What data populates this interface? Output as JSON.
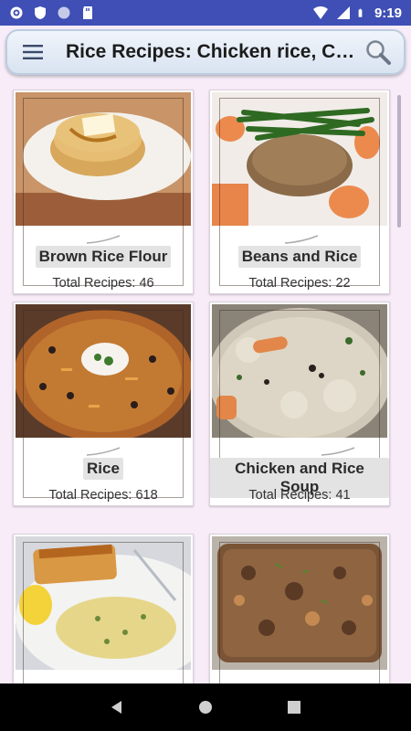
{
  "status_bar": {
    "time": "9:19",
    "left_icons": [
      "gear-icon",
      "shield-icon",
      "circle-icon",
      "sd-card-icon"
    ],
    "right_icons": [
      "wifi-icon",
      "signal-icon",
      "battery-icon"
    ]
  },
  "app_bar": {
    "title": "Rice Recipes: Chicken rice, Chicken and rice"
  },
  "colors": {
    "status_bar": "#3f4fb5",
    "background": "#f7ecf7",
    "nav_bar": "#000000"
  },
  "categories": [
    {
      "title": "Brown Rice Flour",
      "count_text": "Total Recipes: 46",
      "image": "pancakes"
    },
    {
      "title": "Beans and Rice",
      "count_text": "Total Recipes: 22",
      "image": "beans-rice"
    },
    {
      "title": "Rice",
      "count_text": "Total Recipes: 618",
      "image": "mexican-rice"
    },
    {
      "title": "Chicken and Rice Soup",
      "count_text": "Total Recipes: 41",
      "image": "soup"
    },
    {
      "title": "",
      "count_text": "",
      "image": "orzo-chicken"
    },
    {
      "title": "",
      "count_text": "",
      "image": "casserole"
    }
  ]
}
